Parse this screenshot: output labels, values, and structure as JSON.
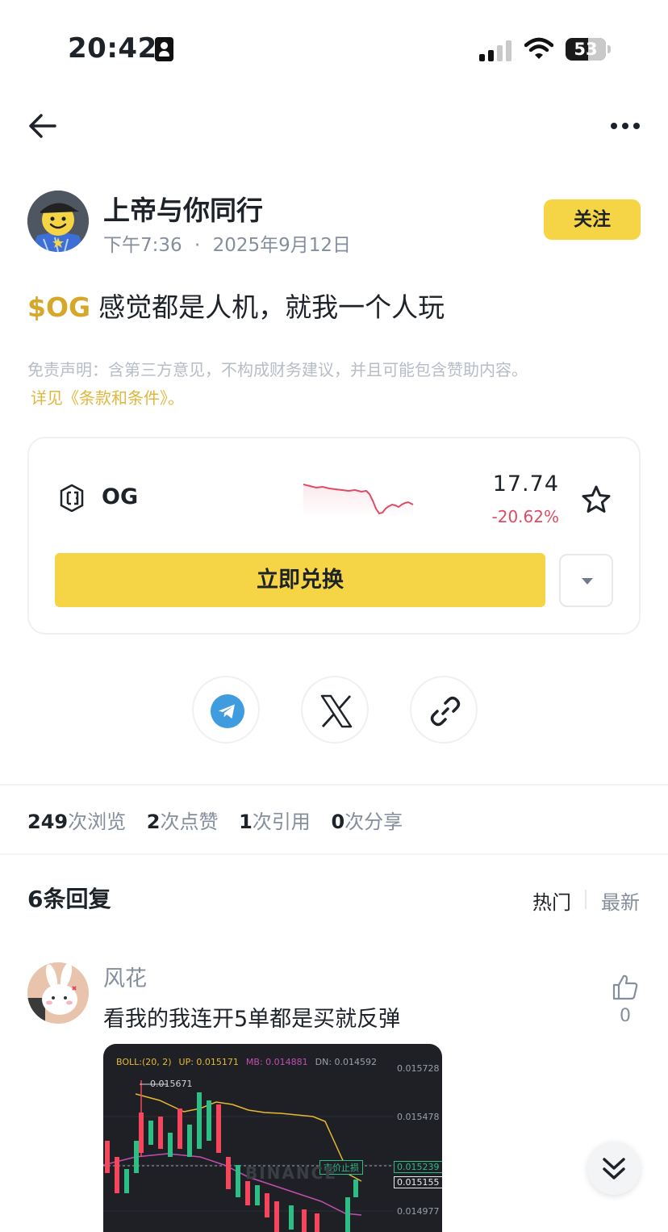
{
  "status_bar": {
    "time": "20:42",
    "battery": "53"
  },
  "author": {
    "name": "上帝与你同行",
    "time": "下午7:36",
    "date": "2025年9月12日",
    "follow_label": "关注"
  },
  "post": {
    "ticker": "$OG",
    "text": "感觉都是人机，就我一个人玩",
    "disclaimer": "免责声明：含第三方意见，不构成财务建议，并且可能包含赞助内容。",
    "terms_link": "详见《条款和条件》。"
  },
  "token": {
    "name": "OG",
    "price": "17.74",
    "change": "-20.62%",
    "swap_label": "立即兑换",
    "change_color": "#e04b64"
  },
  "share": {
    "telegram_color": "#3f9cde"
  },
  "stats": [
    {
      "count": "249",
      "label": "次浏览"
    },
    {
      "count": "2",
      "label": "次点赞"
    },
    {
      "count": "1",
      "label": "次引用"
    },
    {
      "count": "0",
      "label": "次分享"
    }
  ],
  "replies": {
    "title": "6条回复",
    "tabs": [
      "热门",
      "最新"
    ],
    "comments": [
      {
        "user": "风花",
        "text": "看我的我连开5单都是买就反弹",
        "likes": "0",
        "image": {
          "legend": {
            "indicator": "BOLL:(20, 2)",
            "up": "UP: 0.015171",
            "mb": "MB: 0.014881",
            "dn": "DN: 0.014592"
          },
          "high_label": "0.015671",
          "price_ticks": [
            "0.015728",
            "0.015478",
            "0.015239",
            "0.015155",
            "0.014977"
          ],
          "order_tag": "市价止损",
          "watermark": "BINANCE"
        }
      }
    ]
  },
  "colors": {
    "accent": "#f5d546",
    "link": "#e0b73c",
    "down": "#e04b64",
    "up": "#2ebd85"
  }
}
